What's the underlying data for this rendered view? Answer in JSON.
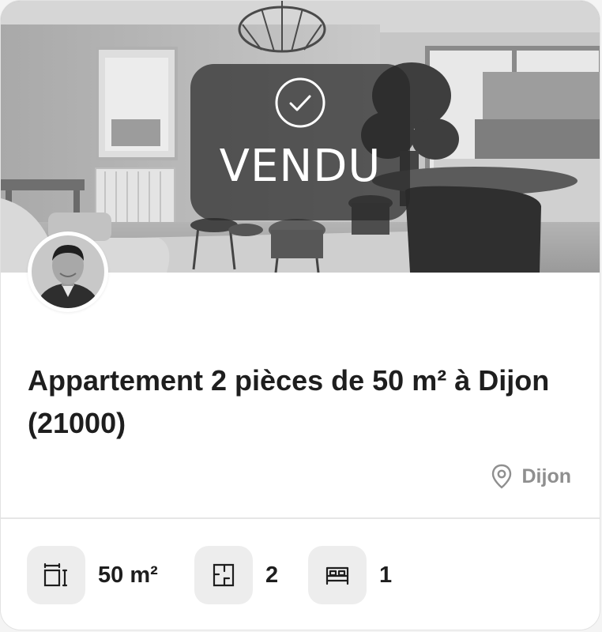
{
  "status": {
    "label": "VENDU",
    "icon": "check-circle-icon"
  },
  "agent": {
    "avatar_icon": "agent-avatar"
  },
  "listing": {
    "title": "Appartement 2 pièces de 50 m² à Dijon (21000)",
    "location": "Dijon",
    "location_icon": "map-pin-icon"
  },
  "features": {
    "surface": {
      "value": "50 m²",
      "icon": "surface-icon"
    },
    "rooms": {
      "value": "2",
      "icon": "floorplan-icon"
    },
    "bedrooms": {
      "value": "1",
      "icon": "bed-icon"
    }
  },
  "colors": {
    "card_bg": "#ffffff",
    "text": "#1e1e1e",
    "muted": "#8f8f8f",
    "icon_bg": "#ededed",
    "overlay": "#282828"
  }
}
